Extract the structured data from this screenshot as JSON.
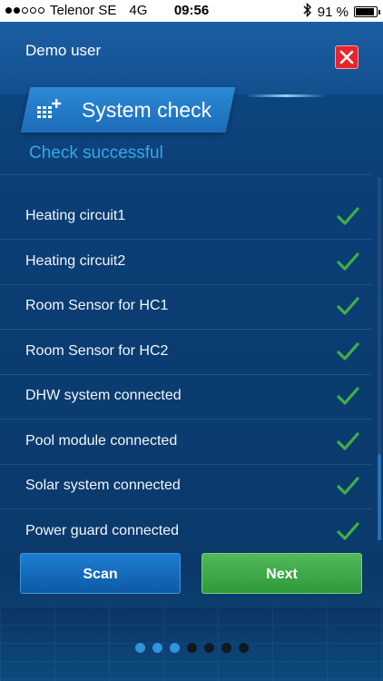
{
  "status_bar": {
    "signal_dots": [
      true,
      true,
      false,
      false,
      false
    ],
    "carrier": "Telenor SE",
    "network": "4G",
    "time": "09:56",
    "bluetooth_icon": "bluetooth-icon",
    "battery_percent": "91 %",
    "battery_level": 0.91
  },
  "header": {
    "user_name": "Demo user",
    "close_icon": "close-icon"
  },
  "title": {
    "text": "System check",
    "icon": "device-add-icon"
  },
  "status_message": "Check successful",
  "check_items": [
    {
      "label": "Heating circuit1",
      "status": "ok"
    },
    {
      "label": "Heating circuit2",
      "status": "ok"
    },
    {
      "label": "Room Sensor for HC1",
      "status": "ok"
    },
    {
      "label": "Room Sensor for HC2",
      "status": "ok"
    },
    {
      "label": "DHW system connected",
      "status": "ok"
    },
    {
      "label": "Pool module connected",
      "status": "ok"
    },
    {
      "label": "Solar system connected",
      "status": "ok"
    },
    {
      "label": "Power guard connected",
      "status": "ok"
    }
  ],
  "buttons": {
    "scan": "Scan",
    "next": "Next"
  },
  "pager": {
    "total": 7,
    "active": [
      0,
      1,
      2
    ]
  },
  "colors": {
    "accent": "#37a6ea",
    "check": "#3fae49",
    "close": "#e8242e",
    "next_button": "#3fae49",
    "scan_button": "#136bb9"
  }
}
